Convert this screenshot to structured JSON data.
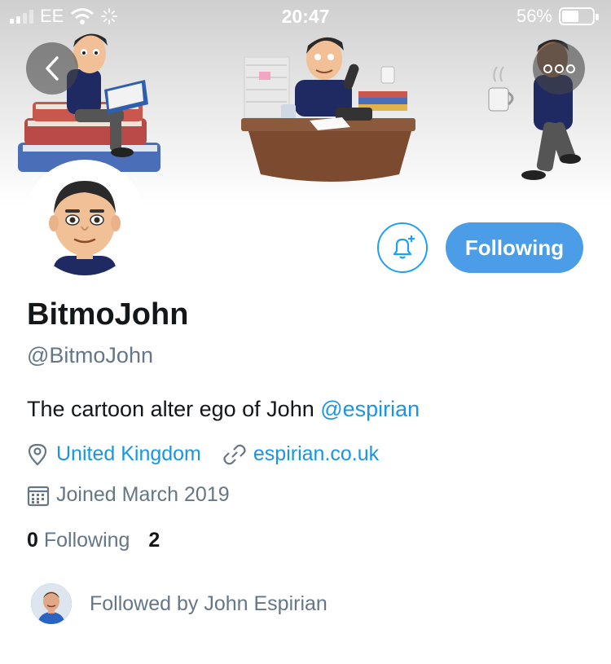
{
  "status_bar": {
    "carrier": "EE",
    "time": "20:47",
    "battery_percent": "56%",
    "battery_level": 0.56
  },
  "nav": {
    "back_icon": "chevron-left-icon",
    "more_icon": "more-dots-icon"
  },
  "profile": {
    "display_name": "BitmoJohn",
    "handle": "@BitmoJohn",
    "bio_text": "The cartoon alter ego of John ",
    "bio_mention": "@espirian",
    "location": "United Kingdom",
    "website": "espirian.co.uk",
    "joined": "Joined March 2019"
  },
  "actions": {
    "notify_icon": "bell-plus-icon",
    "following_label": "Following"
  },
  "counts": {
    "following_count": "0",
    "following_label": "Following",
    "followers_count": "2"
  },
  "followed_by": {
    "text": "Followed by John Espirian"
  },
  "colors": {
    "accent": "#1da1f2",
    "button": "#4a9de6",
    "link": "#1b95e0",
    "secondary_text": "#657786",
    "primary_text": "#14171a"
  }
}
